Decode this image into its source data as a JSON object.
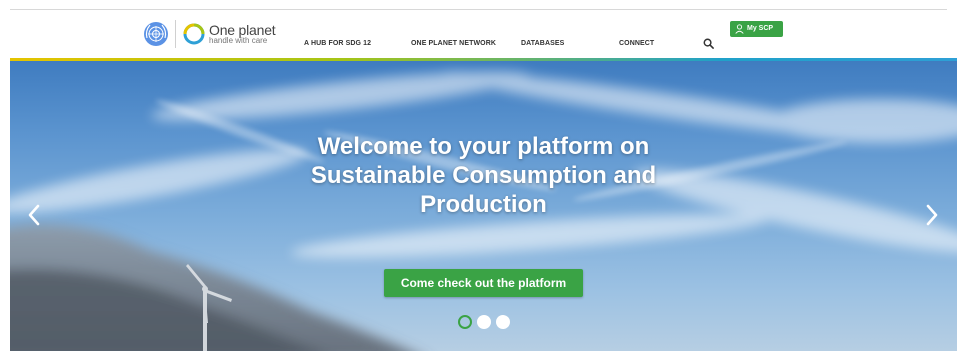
{
  "brand": {
    "title": "One planet",
    "subtitle": "handle with care"
  },
  "nav": [
    {
      "label": "A HUB FOR SDG 12"
    },
    {
      "label": "ONE PLANET NETWORK"
    },
    {
      "label": "DATABASES"
    },
    {
      "label": "CONNECT"
    }
  ],
  "my_scp": {
    "label": "My SCP"
  },
  "hero": {
    "title_lines": [
      "Welcome to your platform on",
      "Sustainable Consumption and",
      "Production"
    ],
    "cta_label": "Come check out the platform",
    "slide_count": 3,
    "active_slide": 1
  },
  "colors": {
    "accent_green": "#3aa345",
    "hero_sky": "#5b94cf"
  },
  "icons": [
    "un-emblem-icon",
    "one-planet-logo-icon",
    "search-icon",
    "user-icon",
    "chevron-left-icon",
    "chevron-right-icon"
  ]
}
